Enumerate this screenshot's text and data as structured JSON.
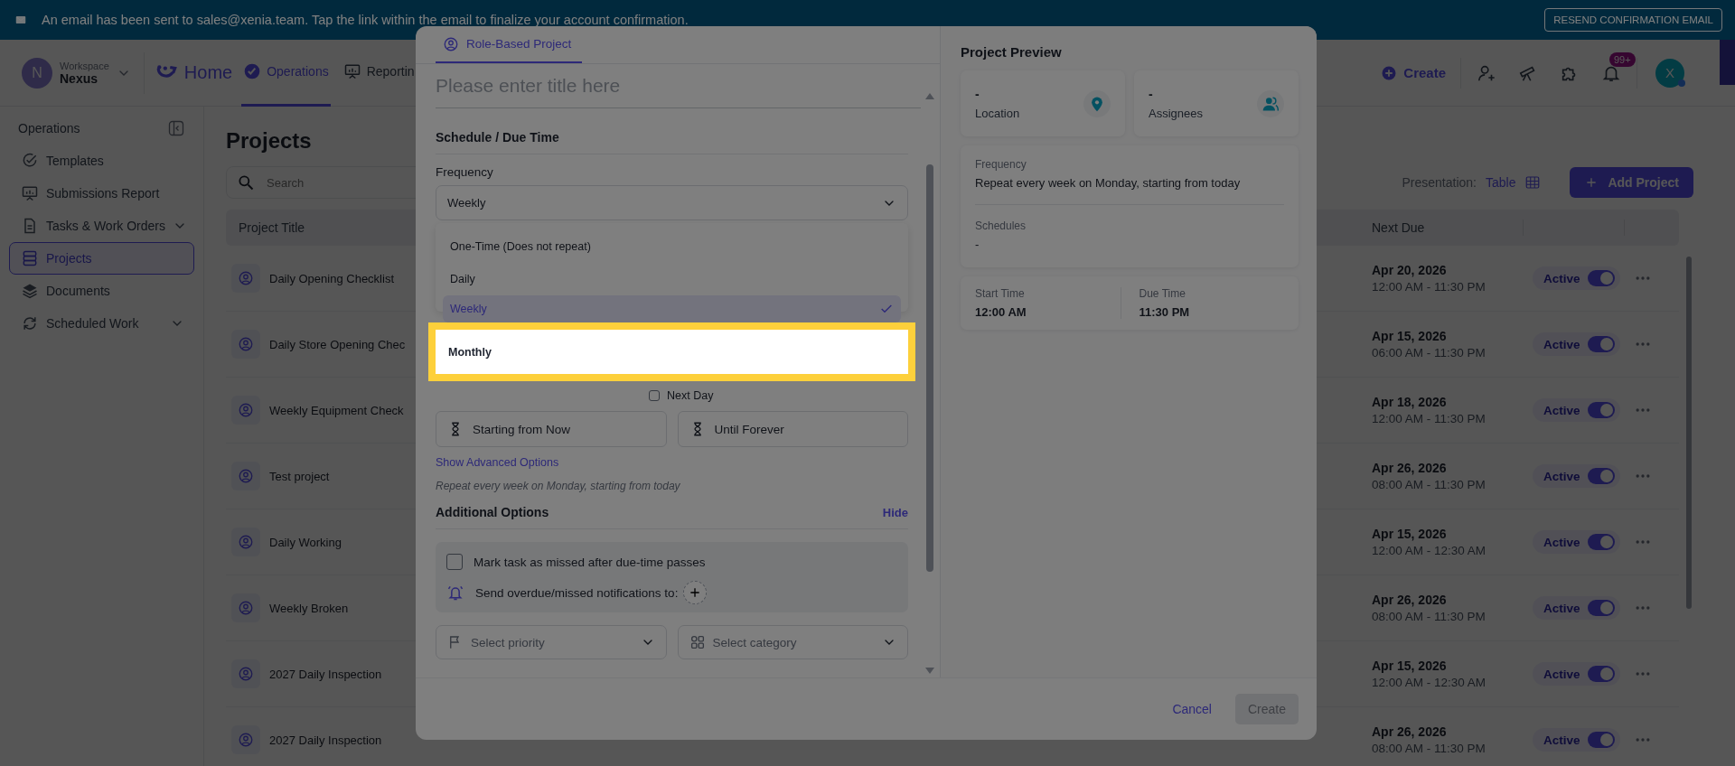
{
  "banner": {
    "message": "An email has been sent to sales@xenia.team. Tap the link within the email to finalize your account confirmation.",
    "button": "RESEND CONFIRMATION EMAIL"
  },
  "header": {
    "workspace_initial": "N",
    "workspace_label": "Workspace",
    "workspace_name": "Nexus",
    "home": "Home",
    "nav": [
      {
        "label": "Operations",
        "selected": true
      },
      {
        "label": "Reportin",
        "selected": false
      }
    ],
    "create": "Create",
    "notification_badge": "99+",
    "user_initial": "X"
  },
  "sidebar": {
    "title": "Operations",
    "items": [
      {
        "label": "Templates",
        "expandable": false,
        "selected": false
      },
      {
        "label": "Submissions Report",
        "expandable": false,
        "selected": false
      },
      {
        "label": "Tasks & Work Orders",
        "expandable": true,
        "selected": false
      },
      {
        "label": "Projects",
        "expandable": false,
        "selected": true
      },
      {
        "label": "Documents",
        "expandable": false,
        "selected": false
      },
      {
        "label": "Scheduled Work",
        "expandable": true,
        "selected": false
      }
    ]
  },
  "page": {
    "title": "Projects",
    "search_placeholder": "Search",
    "presentation_label": "Presentation:",
    "presentation_value": "Table",
    "add_button": "Add Project"
  },
  "table": {
    "columns": [
      "Project Title",
      "Next Due"
    ],
    "rows": [
      {
        "title": "Daily Opening Checklist",
        "due_date": "Apr 20, 2026",
        "due_time": "12:00 AM - 11:30 PM",
        "status": "Active",
        "on": true
      },
      {
        "title": "Daily Store Opening Chec",
        "due_date": "Apr 15, 2026",
        "due_time": "06:00 AM - 11:30 PM",
        "status": "Active",
        "on": true
      },
      {
        "title": "Weekly Equipment Check",
        "due_date": "Apr 18, 2026",
        "due_time": "12:00 AM - 11:30 PM",
        "status": "Active",
        "on": true
      },
      {
        "title": "Test project",
        "due_date": "Apr 26, 2026",
        "due_time": "08:00 AM - 11:30 PM",
        "status": "Active",
        "on": true
      },
      {
        "title": "Daily Working",
        "due_date": "Apr 15, 2026",
        "due_time": "12:00 AM - 12:30 AM",
        "status": "Active",
        "on": true
      },
      {
        "title": "Weekly Broken",
        "due_date": "Apr 26, 2026",
        "due_time": "08:00 AM - 11:30 PM",
        "status": "Active",
        "on": true
      },
      {
        "title": "2027 Daily Inspection",
        "due_date": "Apr 15, 2026",
        "due_time": "12:00 AM - 12:30 AM",
        "status": "Active",
        "on": true
      },
      {
        "title": "2027 Daily Inspection",
        "due_date": "Apr 26, 2026",
        "due_time": "08:00 AM - 11:30 PM",
        "status": "Active",
        "on": true
      }
    ]
  },
  "modal": {
    "tabs": [
      {
        "label": "Role-Based Project",
        "selected": true
      }
    ],
    "title_placeholder": "Please enter title here",
    "schedule_heading": "Schedule / Due Time",
    "frequency_label": "Frequency",
    "frequency_value": "Weekly",
    "options": [
      {
        "label": "One-Time (Does not repeat)",
        "selected": false,
        "highlighted": false
      },
      {
        "label": "Daily",
        "selected": false,
        "highlighted": false
      },
      {
        "label": "Weekly",
        "selected": true,
        "highlighted": false
      },
      {
        "label": "Monthly",
        "selected": false,
        "highlighted": true
      }
    ],
    "next_day": {
      "label": "Next Day",
      "checked": false
    },
    "start_button": "Starting from Now",
    "end_button": "Until Forever",
    "advanced_link": "Show Advanced Options",
    "summary": "Repeat every week on Monday, starting from today",
    "additional_heading": "Additional Options",
    "hide_link": "Hide",
    "missed": {
      "label": "Mark task as missed after due-time passes",
      "checked": false
    },
    "notify_label": "Send overdue/missed notifications to:",
    "priority_placeholder": "Select priority",
    "category_placeholder": "Select category",
    "preview": {
      "title": "Project Preview",
      "location_value": "-",
      "location_label": "Location",
      "assignees_value": "-",
      "assignees_label": "Assignees",
      "frequency_label": "Frequency",
      "frequency_value": "Repeat every week on Monday, starting from today",
      "schedules_label": "Schedules",
      "schedules_value": "-",
      "start_label": "Start Time",
      "start_value": "12:00 AM",
      "due_label": "Due Time",
      "due_value": "11:30 PM"
    },
    "cancel": "Cancel",
    "create": "Create",
    "create_disabled": true
  }
}
